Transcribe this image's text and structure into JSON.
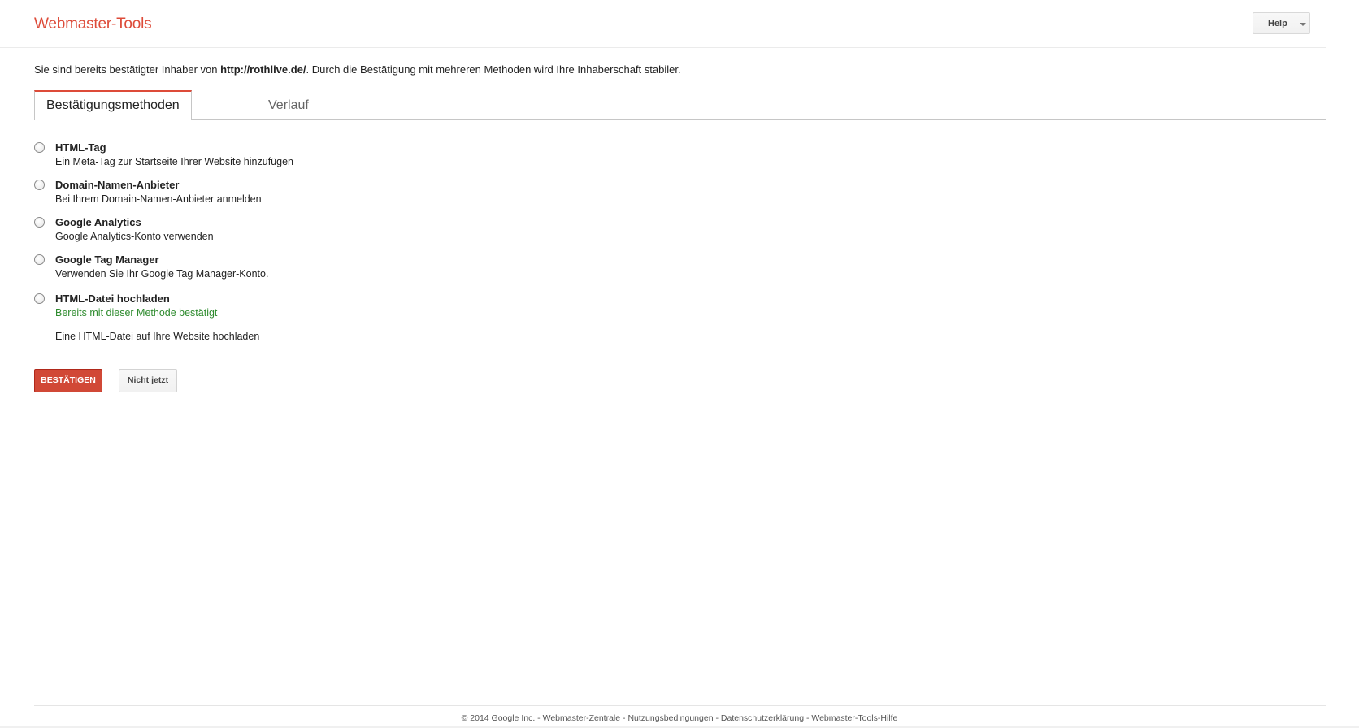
{
  "header": {
    "brand": "Webmaster-Tools",
    "help_label": "Help"
  },
  "intro": {
    "prefix": "Sie sind bereits bestätigter Inhaber von ",
    "site": "http://rothlive.de/",
    "suffix": ". Durch die Bestätigung mit mehreren Methoden wird Ihre Inhaberschaft stabiler."
  },
  "tabs": [
    {
      "label": "Bestätigungsmethoden",
      "active": true
    },
    {
      "label": "Verlauf",
      "active": false
    }
  ],
  "methods": [
    {
      "title": "HTML-Tag",
      "description": "Ein Meta-Tag zur Startseite Ihrer Website hinzufügen"
    },
    {
      "title": "Domain-Namen-Anbieter",
      "description": "Bei Ihrem Domain-Namen-Anbieter anmelden"
    },
    {
      "title": "Google Analytics",
      "description": "Google Analytics-Konto verwenden"
    },
    {
      "title": "Google Tag Manager",
      "description": "Verwenden Sie Ihr Google Tag Manager-Konto."
    },
    {
      "title": "HTML-Datei hochladen",
      "status": "Bereits mit dieser Methode bestätigt",
      "description": "Eine HTML-Datei auf Ihre Website hochladen"
    }
  ],
  "actions": {
    "confirm_label": "BESTÄTIGEN",
    "later_label": "Nicht jetzt"
  },
  "footer": {
    "copyright": "© 2014 Google Inc.",
    "sep": " - ",
    "links": [
      "Webmaster-Zentrale",
      "Nutzungsbedingungen",
      "Datenschutzerklärung",
      "Webmaster-Tools-Hilfe"
    ]
  },
  "colors": {
    "brand": "#dd4b39",
    "primary_button": "#d14836",
    "status_green": "#2e8b2e"
  }
}
